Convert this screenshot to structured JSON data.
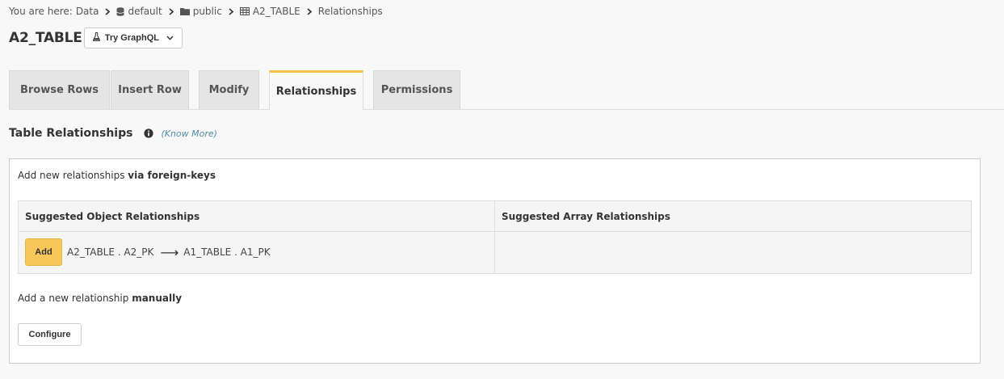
{
  "breadcrumb": {
    "prefix": "You are here:",
    "items": [
      {
        "label": "Data",
        "icon": ""
      },
      {
        "label": "default",
        "icon": "database-icon"
      },
      {
        "label": "public",
        "icon": "folder-icon"
      },
      {
        "label": "A2_TABLE",
        "icon": "table-icon"
      },
      {
        "label": "Relationships",
        "icon": ""
      }
    ]
  },
  "header": {
    "title": "A2_TABLE",
    "graphql_button": "Try GraphQL"
  },
  "tabs": [
    {
      "label": "Browse Rows",
      "active": false
    },
    {
      "label": "Insert Row",
      "active": false
    },
    {
      "label": "Modify",
      "active": false
    },
    {
      "label": "Relationships",
      "active": true
    },
    {
      "label": "Permissions",
      "active": false
    }
  ],
  "section": {
    "title": "Table Relationships",
    "know_more": "(Know More)"
  },
  "foreign_keys": {
    "intro": "Add new relationships ",
    "intro_bold": "via foreign-keys",
    "columns": [
      "Suggested Object Relationships",
      "Suggested Array Relationships"
    ],
    "object_suggestion": {
      "add_label": "Add",
      "from": "A2_TABLE . A2_PK",
      "arrow": "⟶",
      "to": "A1_TABLE . A1_PK"
    }
  },
  "manual": {
    "intro": "Add a new relationship ",
    "intro_bold": "manually",
    "configure_label": "Configure"
  },
  "colors": {
    "accent": "#f7c04a",
    "link": "#4f8ea8"
  }
}
